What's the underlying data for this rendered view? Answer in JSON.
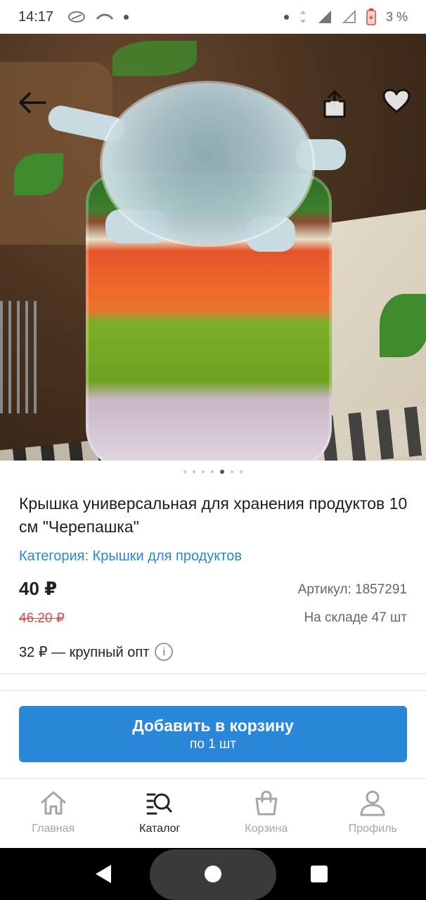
{
  "status_bar": {
    "time": "14:17",
    "battery": "3 %"
  },
  "hero": {
    "image_alt": "salad-jar-with-silicone-lid",
    "icons": {
      "back": "arrow-left-icon",
      "share": "share-icon",
      "favorite": "heart-icon"
    }
  },
  "pager": {
    "count": 7,
    "active_index": 4
  },
  "product": {
    "title": "Крышка универсальная для хранения продуктов 10 см \"Черепашка\"",
    "category": "Категория: Крышки для продуктов",
    "price": "40 ₽",
    "old_price": "46.20 ₽",
    "sku": "Артикул: 1857291",
    "stock": "На складе 47 шт",
    "wholesale": "32 ₽ — крупный опт"
  },
  "cart_button": {
    "label": "Добавить в корзину",
    "sublabel": "по 1 шт"
  },
  "bottom_nav": {
    "items": [
      {
        "label": "Главная",
        "icon": "home-icon",
        "active": false
      },
      {
        "label": "Каталог",
        "icon": "catalog-search-icon",
        "active": true
      },
      {
        "label": "Корзина",
        "icon": "bag-icon",
        "active": false
      },
      {
        "label": "Профиль",
        "icon": "profile-icon",
        "active": false
      }
    ]
  },
  "colors": {
    "accent": "#2a86d8",
    "link": "#2b86d6",
    "old_price": "#d24b4b",
    "nav_inactive": "#a6a6a6"
  }
}
